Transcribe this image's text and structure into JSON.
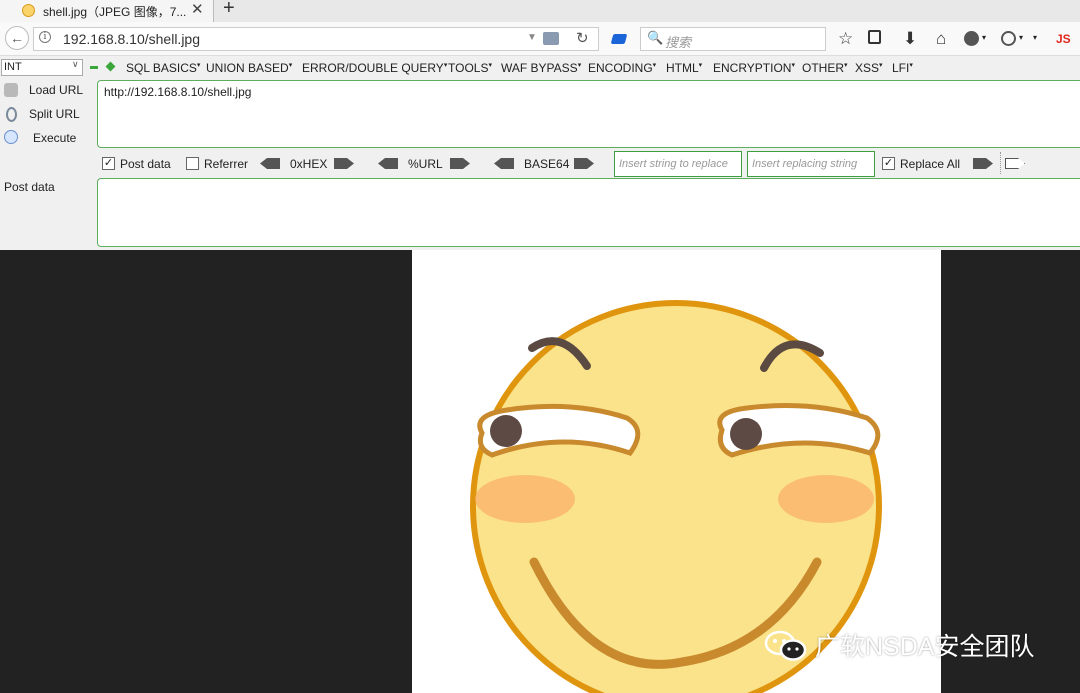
{
  "tab": {
    "title": "shell.jpg（JPEG 图像，7...",
    "close": "✕",
    "new_tab": "+"
  },
  "nav": {
    "back": "←",
    "info": "i",
    "url": "192.168.8.10/shell.jpg",
    "reload": "↻",
    "search_placeholder": "搜索",
    "search_icon": "🔍",
    "js": "JS"
  },
  "toolbar_icons": [
    "star-icon",
    "reader-icon",
    "download-icon",
    "home-icon",
    "globe-icon",
    "palette-icon",
    "menu-icon"
  ],
  "hackbar": {
    "select_value": "INT",
    "menus": [
      "SQL BASICS",
      "UNION BASED",
      "ERROR/DOUBLE QUERY",
      "TOOLS",
      "WAF BYPASS",
      "ENCODING",
      "HTML",
      "ENCRYPTION",
      "OTHER",
      "XSS",
      "LFI"
    ],
    "load_url": "Load URL",
    "split_url": "Split URL",
    "execute": "Execute",
    "url_value": "http://192.168.8.10/shell.jpg",
    "post_data_checkbox": "Post data",
    "post_data_checked": true,
    "referrer_checkbox": "Referrer",
    "referrer_checked": false,
    "hex_label": "0xHEX",
    "url_label": "%URL",
    "base64_label": "BASE64",
    "replace_placeholder": "Insert string to replace",
    "replacing_placeholder": "Insert replacing string",
    "replace_all_label": "Replace All",
    "replace_all_checked": true,
    "post_data_label": "Post data"
  },
  "content": {
    "colors": {
      "face": "#fbe38b",
      "outline": "#e0950e",
      "brow": "#5a4a42",
      "pupil": "#5e4a44",
      "blush": "#f9b06a",
      "mouth": "#c98a2e"
    }
  },
  "watermark": {
    "text": "广软NSDA安全团队"
  }
}
